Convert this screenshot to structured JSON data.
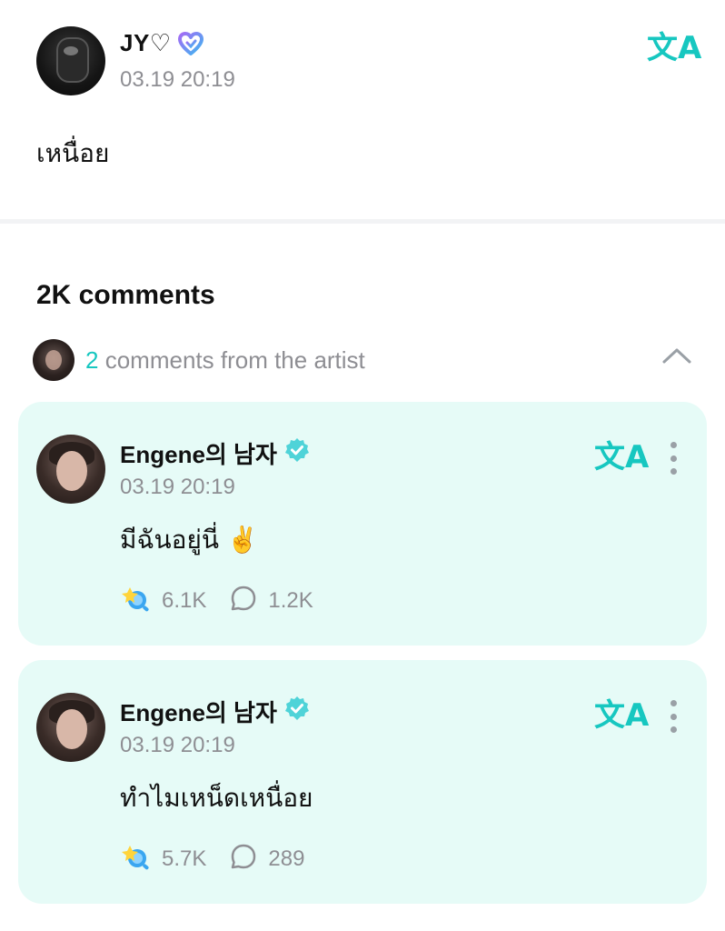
{
  "post": {
    "author": "JY♡",
    "time": "03.19 20:19",
    "body": "เหนื่อย",
    "translate_icon": "文A"
  },
  "comments_section": {
    "count_label": "2K comments",
    "artist_count": "2",
    "artist_label": "comments from the artist"
  },
  "comments": [
    {
      "author": "Engene의 남자",
      "time": "03.19 20:19",
      "text": "มีฉันอยู่นี่ ✌️",
      "likes": "6.1K",
      "replies": "1.2K"
    },
    {
      "author": "Engene의 남자",
      "time": "03.19 20:19",
      "text": "ทำไมเหน็ดเหนื่อย",
      "likes": "5.7K",
      "replies": "289"
    }
  ],
  "colors": {
    "accent": "#17c7c0",
    "card_bg": "#e6fbf7",
    "muted": "#8e8e93"
  },
  "icons": [
    "heart-icon",
    "membership-heart-icon",
    "translate-icon",
    "verified-badge-icon",
    "more-icon",
    "chevron-up-icon",
    "like-reaction-icon",
    "reply-bubble-icon"
  ]
}
